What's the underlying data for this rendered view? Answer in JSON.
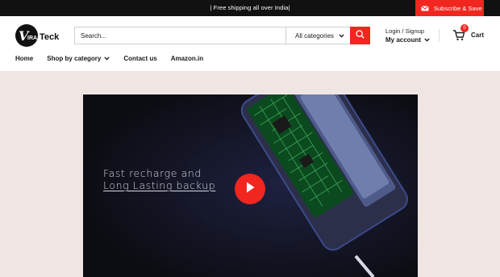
{
  "announcement": "| Free shipping all over India|",
  "subscribe_label": "Subscribe & Save",
  "logo": {
    "text": "Viratech",
    "mark": "V",
    "wordmark": "Teck",
    "prefix": "IRA"
  },
  "search": {
    "placeholder": "Search...",
    "category": "All categories"
  },
  "account": {
    "login": "Login / Signup",
    "my_account": "My account"
  },
  "cart": {
    "label": "Cart",
    "count": "0"
  },
  "nav": [
    {
      "label": "Home"
    },
    {
      "label": "Shop by category"
    },
    {
      "label": "Contact us"
    },
    {
      "label": "Amazon.in"
    }
  ],
  "video": {
    "caption_line1": "Fast recharge and",
    "caption_line2": "Long Lasting backup"
  },
  "colors": {
    "accent": "#f0261f",
    "topbar": "#111111",
    "page_bg": "#efe6e4"
  },
  "icons": [
    "mail-icon",
    "search-icon",
    "chevron-down-icon",
    "cart-icon",
    "play-icon"
  ]
}
